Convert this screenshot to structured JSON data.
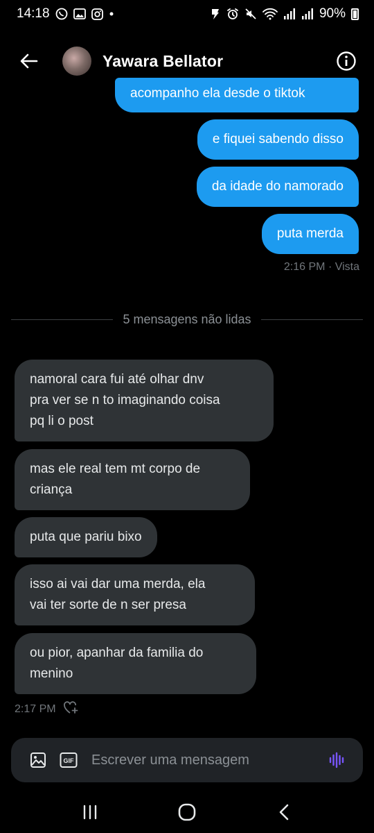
{
  "status_bar": {
    "time": "14:18",
    "battery_text": "90%",
    "left_icons": [
      "whatsapp-icon",
      "gallery-icon",
      "instagram-icon",
      "dot-icon"
    ],
    "right_icons": [
      "alarm-app-icon",
      "alarm-icon",
      "mute-icon",
      "wifi-icon",
      "signal-icon",
      "signal-icon",
      "battery-icon"
    ]
  },
  "header": {
    "contact_name": "Yawara Bellator",
    "back_icon": "arrow-left-icon",
    "info_icon": "info-circle-icon"
  },
  "conversation": {
    "sent": [
      {
        "text": "acompanho ela desde o tiktok"
      },
      {
        "text": "e fiquei sabendo disso"
      },
      {
        "text": "da idade do namorado"
      },
      {
        "text": "puta merda"
      }
    ],
    "sent_meta": "2:16 PM · Vista",
    "unread_divider": "5 mensagens não lidas",
    "received": [
      {
        "lines": [
          "namoral cara fui até olhar dnv",
          "pra ver se n to imaginando coisa",
          "pq li o post"
        ]
      },
      {
        "lines": [
          "mas ele real tem mt corpo de",
          "criança"
        ]
      },
      {
        "lines": [
          "puta que pariu bixo"
        ]
      },
      {
        "lines": [
          "isso ai vai dar uma merda, ela",
          "vai ter sorte de n ser presa"
        ]
      },
      {
        "lines": [
          "ou pior, apanhar da familia do",
          "menino"
        ]
      }
    ],
    "received_meta": "2:17 PM"
  },
  "composer": {
    "placeholder": "Escrever uma mensagem",
    "value": "",
    "gif_label": "GIF",
    "accent_color": "#7856ff"
  },
  "nav_bar": {
    "icons": [
      "recent-apps-icon",
      "home-icon",
      "back-icon"
    ]
  },
  "colors": {
    "sent_bubble": "#1d9bf0",
    "received_bubble": "#2f3336",
    "background": "#000000",
    "meta_text": "#71767b"
  }
}
